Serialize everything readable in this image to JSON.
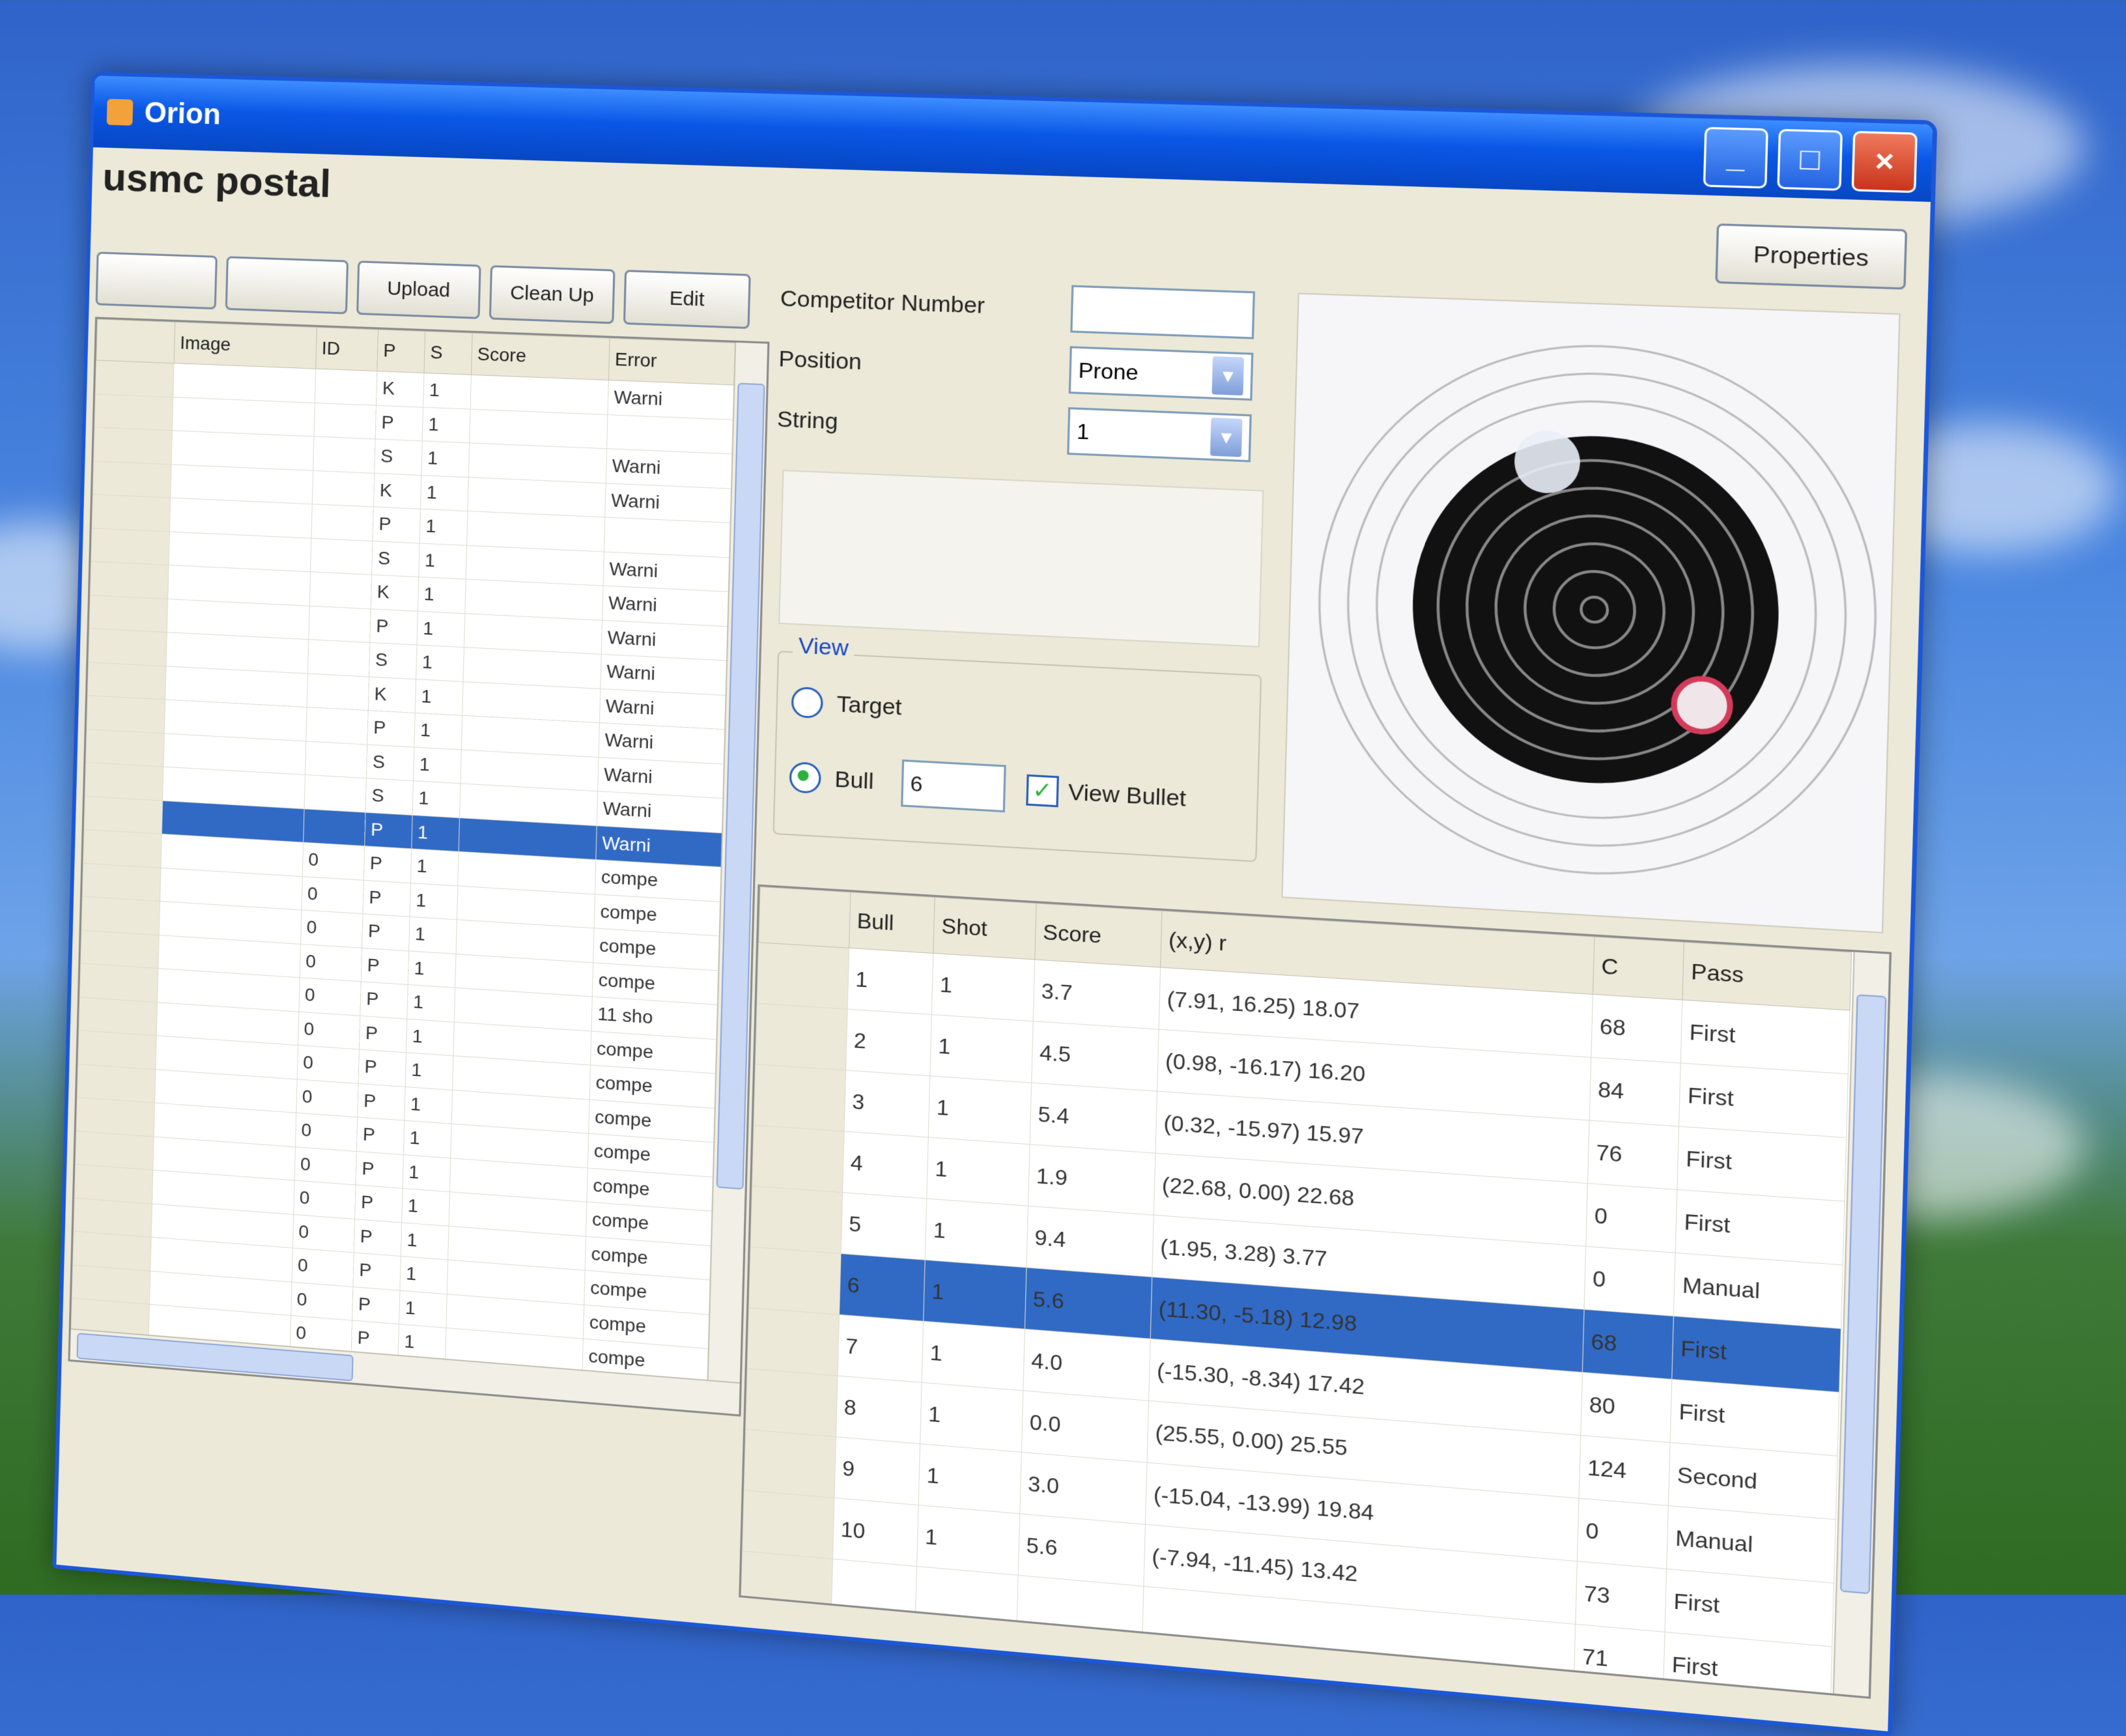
{
  "window": {
    "title": "Orion"
  },
  "header": {
    "app_title": "usmc postal",
    "subtitle": ""
  },
  "toolbar": [
    {
      "label": ""
    },
    {
      "label": ""
    },
    {
      "label": "Upload"
    },
    {
      "label": "Clean Up"
    },
    {
      "label": "Edit"
    }
  ],
  "properties_label": "Properties",
  "left_grid": {
    "columns": [
      "Image",
      "ID",
      "P",
      "S",
      "Score",
      "Error"
    ],
    "rows": [
      [
        "",
        "",
        "K",
        "1",
        "",
        "Warni"
      ],
      [
        "",
        "",
        "P",
        "1",
        "",
        ""
      ],
      [
        "",
        "",
        "S",
        "1",
        "",
        "Warni"
      ],
      [
        "",
        "",
        "K",
        "1",
        "",
        "Warni"
      ],
      [
        "",
        "",
        "P",
        "1",
        "",
        ""
      ],
      [
        "",
        "",
        "S",
        "1",
        "",
        "Warni"
      ],
      [
        "",
        "",
        "K",
        "1",
        "",
        "Warni"
      ],
      [
        "",
        "",
        "P",
        "1",
        "",
        "Warni"
      ],
      [
        "",
        "",
        "S",
        "1",
        "",
        "Warni"
      ],
      [
        "",
        "",
        "K",
        "1",
        "",
        "Warni"
      ],
      [
        "",
        "",
        "P",
        "1",
        "",
        "Warni"
      ],
      [
        "",
        "",
        "S",
        "1",
        "",
        "Warni"
      ],
      [
        "",
        "",
        "S",
        "1",
        "",
        "Warni"
      ],
      [
        "",
        "",
        "P",
        "1",
        "",
        "Warni"
      ],
      [
        "",
        "0",
        "P",
        "1",
        "",
        "compe"
      ],
      [
        "",
        "0",
        "P",
        "1",
        "",
        "compe"
      ],
      [
        "",
        "0",
        "P",
        "1",
        "",
        "compe"
      ],
      [
        "",
        "0",
        "P",
        "1",
        "",
        "compe"
      ],
      [
        "",
        "0",
        "P",
        "1",
        "",
        "11 sho"
      ],
      [
        "",
        "0",
        "P",
        "1",
        "",
        "compe"
      ],
      [
        "",
        "0",
        "P",
        "1",
        "",
        "compe"
      ],
      [
        "",
        "0",
        "P",
        "1",
        "",
        "compe"
      ],
      [
        "",
        "0",
        "P",
        "1",
        "",
        "compe"
      ],
      [
        "",
        "0",
        "P",
        "1",
        "",
        "compe"
      ],
      [
        "",
        "0",
        "P",
        "1",
        "",
        "compe"
      ],
      [
        "",
        "0",
        "P",
        "1",
        "",
        "compe"
      ],
      [
        "",
        "0",
        "P",
        "1",
        "",
        "compe"
      ],
      [
        "",
        "0",
        "P",
        "1",
        "",
        "compe"
      ],
      [
        "",
        "0",
        "P",
        "1",
        "",
        "compe"
      ],
      [
        "",
        "0",
        "P",
        "1",
        "",
        "compe"
      ]
    ],
    "selected_index": 13
  },
  "form": {
    "competitor_label": "Competitor Number",
    "competitor_value": "",
    "position_label": "Position",
    "position_value": "Prone",
    "string_label": "String",
    "string_value": "1"
  },
  "digits_text": "",
  "view": {
    "legend": "View",
    "target_label": "Target",
    "bull_label": "Bull",
    "bull_value": "6",
    "view_bullet_label": "View Bullet"
  },
  "right_grid": {
    "columns": [
      "Bull",
      "Shot",
      "Score",
      "(x,y) r",
      "C",
      "Pass"
    ],
    "rows": [
      [
        "1",
        "1",
        "3.7",
        "(7.91, 16.25) 18.07",
        "68",
        "First"
      ],
      [
        "2",
        "1",
        "4.5",
        "(0.98, -16.17) 16.20",
        "84",
        "First"
      ],
      [
        "3",
        "1",
        "5.4",
        "(0.32, -15.97) 15.97",
        "76",
        "First"
      ],
      [
        "4",
        "1",
        "1.9",
        "(22.68, 0.00) 22.68",
        "0",
        "First"
      ],
      [
        "5",
        "1",
        "9.4",
        "(1.95, 3.28) 3.77",
        "0",
        "Manual"
      ],
      [
        "6",
        "1",
        "5.6",
        "(11.30, -5.18) 12.98",
        "68",
        "First"
      ],
      [
        "7",
        "1",
        "4.0",
        "(-15.30, -8.34) 17.42",
        "80",
        "First"
      ],
      [
        "8",
        "1",
        "0.0",
        "(25.55, 0.00) 25.55",
        "124",
        "Second"
      ],
      [
        "9",
        "1",
        "3.0",
        "(-15.04, -13.99) 19.84",
        "0",
        "Manual"
      ],
      [
        "10",
        "1",
        "5.6",
        "(-7.94, -11.45) 13.42",
        "73",
        "First"
      ],
      [
        "",
        "",
        "",
        "",
        "71",
        "First"
      ]
    ],
    "selected_index": 5
  },
  "colors": {
    "accent": "#316ac5",
    "titlebar": "#0a57e6",
    "close": "#c8341c",
    "target_black": "#111111"
  }
}
